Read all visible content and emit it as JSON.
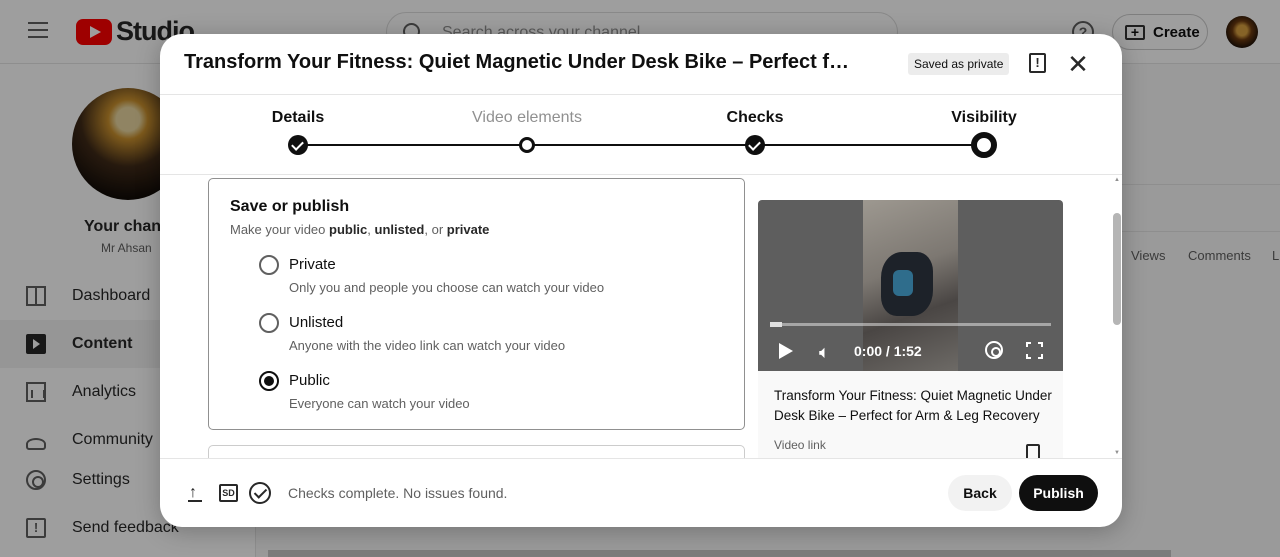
{
  "studio": {
    "logo_text": "Studio",
    "search_placeholder": "Search across your channel",
    "create_label": "Create",
    "channel_title": "Your channel",
    "channel_name": "Mr Ahsan",
    "nav": [
      {
        "label": "Dashboard",
        "icon": "dashboard-icon"
      },
      {
        "label": "Content",
        "icon": "content-icon"
      },
      {
        "label": "Analytics",
        "icon": "analytics-icon"
      },
      {
        "label": "Community",
        "icon": "community-icon"
      },
      {
        "label": "Settings",
        "icon": "settings-icon"
      },
      {
        "label": "Send feedback",
        "icon": "feedback-icon"
      }
    ],
    "column_headers": [
      "Views",
      "Comments",
      "L"
    ]
  },
  "dialog": {
    "title": "Transform Your Fitness: Quiet Magnetic Under Desk Bike – Perfect for Arm & Leg Recovery",
    "saved_badge": "Saved as private",
    "steps": [
      {
        "label": "Details",
        "state": "done"
      },
      {
        "label": "Video elements",
        "state": "pending"
      },
      {
        "label": "Checks",
        "state": "done"
      },
      {
        "label": "Visibility",
        "state": "current"
      }
    ],
    "save": {
      "title": "Save or publish",
      "sub_prefix": "Make your video ",
      "sub_public": "public",
      "sub_sep1": ", ",
      "sub_unlisted": "unlisted",
      "sub_sep2": ", or ",
      "sub_private": "private",
      "options": [
        {
          "label": "Private",
          "desc": "Only you and people you choose can watch your video",
          "selected": false
        },
        {
          "label": "Unlisted",
          "desc": "Anyone with the video link can watch your video",
          "selected": false
        },
        {
          "label": "Public",
          "desc": "Everyone can watch your video",
          "selected": true
        }
      ]
    },
    "preview": {
      "time": "0:00 / 1:52",
      "title": "Transform Your Fitness: Quiet Magnetic Under Desk Bike – Perfect for Arm & Leg Recovery",
      "link_label": "Video link"
    },
    "footer": {
      "sd_label": "SD",
      "status": "Checks complete. No issues found.",
      "back": "Back",
      "publish": "Publish"
    }
  },
  "colors": {
    "brand": "#ff0000",
    "primary_button": "#0f0f0f"
  }
}
